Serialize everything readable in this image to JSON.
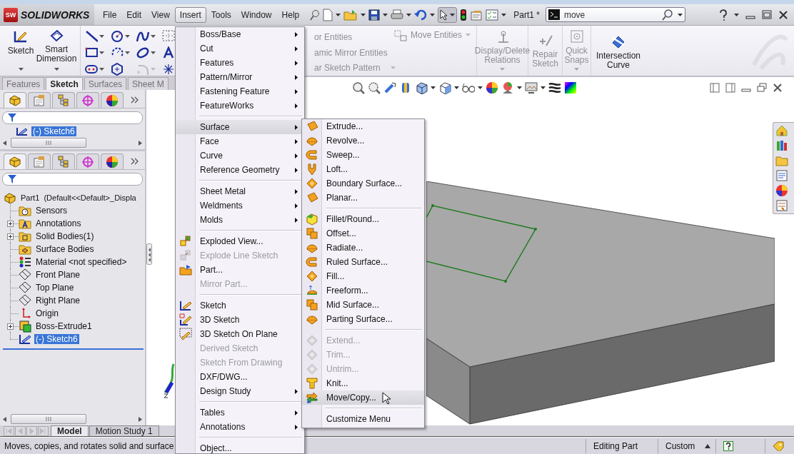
{
  "title_bar": {
    "logo_badge": "SW",
    "logo": "SOLIDWORKS",
    "menus": [
      {
        "label": "File",
        "selected": false
      },
      {
        "label": "Edit",
        "selected": false
      },
      {
        "label": "View",
        "selected": false
      },
      {
        "label": "Insert",
        "selected": true
      },
      {
        "label": "Tools",
        "selected": false
      },
      {
        "label": "Window",
        "selected": false
      },
      {
        "label": "Help",
        "selected": false
      }
    ],
    "document": "Part1 *",
    "search": {
      "value": "move"
    }
  },
  "command_manager": {
    "sketch_tools": [
      {
        "label": "Sketch",
        "dropdown": true,
        "disabled": false
      },
      {
        "label": "Smart Dimension",
        "dropdown": true,
        "disabled": false
      }
    ],
    "entity_tools": [
      {
        "label": "or Entities",
        "dropdown": false,
        "disabled": true
      },
      {
        "label": "amic Mirror Entities",
        "dropdown": false,
        "disabled": true
      },
      {
        "label": "ar Sketch Pattern",
        "dropdown": true,
        "disabled": true
      }
    ],
    "move_entities": {
      "label": "Move Entities",
      "dropdown": true,
      "disabled": true
    },
    "relation_tools": [
      {
        "label": "Display/Delete Relations",
        "dropdown": true,
        "disabled": true
      },
      {
        "label": "Repair Sketch",
        "dropdown": false,
        "disabled": true
      },
      {
        "label": "Quick Snaps",
        "dropdown": true,
        "disabled": true
      },
      {
        "label": "Intersection Curve",
        "dropdown": false,
        "disabled": false
      }
    ]
  },
  "command_tabs": [
    {
      "label": "Features",
      "selected": false
    },
    {
      "label": "Sketch",
      "selected": true
    },
    {
      "label": "Surfaces",
      "selected": false
    },
    {
      "label": "Sheet M",
      "selected": false
    }
  ],
  "flyout_tree": {
    "panel_tabs": [
      {
        "selected": true
      },
      {
        "selected": false
      },
      {
        "selected": false
      },
      {
        "selected": false
      },
      {
        "selected": false
      }
    ],
    "item": {
      "label": "(-) Sketch6",
      "selected": true
    }
  },
  "feature_tree": {
    "panel_tabs": [
      {
        "selected": true
      },
      {
        "selected": false
      },
      {
        "selected": false
      },
      {
        "selected": false
      },
      {
        "selected": false
      }
    ],
    "root": {
      "label": "Part1  (Default<<Default>_Displa",
      "children": [
        {
          "label": "Sensors",
          "expandable": false,
          "selected": false
        },
        {
          "label": "Annotations",
          "expandable": true,
          "selected": false
        },
        {
          "label": "Solid Bodies(1)",
          "expandable": true,
          "selected": false
        },
        {
          "label": "Surface Bodies",
          "expandable": false,
          "selected": false
        },
        {
          "label": "Material <not specified>",
          "expandable": false,
          "selected": false
        },
        {
          "label": "Front Plane",
          "expandable": false,
          "selected": false
        },
        {
          "label": "Top Plane",
          "expandable": false,
          "selected": false
        },
        {
          "label": "Right Plane",
          "expandable": false,
          "selected": false
        },
        {
          "label": "Origin",
          "expandable": false,
          "selected": false
        },
        {
          "label": "Boss-Extrude1",
          "expandable": true,
          "selected": false
        },
        {
          "label": "(-) Sketch6",
          "expandable": false,
          "selected": true
        }
      ]
    }
  },
  "bottom_tabs": [
    {
      "label": "Model",
      "selected": true
    },
    {
      "label": "Motion Study 1",
      "selected": false
    }
  ],
  "status_bar": {
    "message": "Moves, copies, and rotates solid and surface",
    "mode": "Editing Part",
    "units": "Custom"
  },
  "insert_menu": {
    "items": [
      {
        "kind": "item",
        "label": "Boss/Base",
        "submenu": true,
        "disabled": false,
        "selected": false
      },
      {
        "kind": "item",
        "label": "Cut",
        "submenu": true,
        "disabled": false,
        "selected": false
      },
      {
        "kind": "item",
        "label": "Features",
        "submenu": true,
        "disabled": false,
        "selected": false
      },
      {
        "kind": "item",
        "label": "Pattern/Mirror",
        "submenu": true,
        "disabled": false,
        "selected": false
      },
      {
        "kind": "item",
        "label": "Fastening Feature",
        "submenu": true,
        "disabled": false,
        "selected": false
      },
      {
        "kind": "item",
        "label": "FeatureWorks",
        "submenu": true,
        "disabled": false,
        "selected": false
      },
      {
        "kind": "separator"
      },
      {
        "kind": "item",
        "label": "Surface",
        "submenu": true,
        "disabled": false,
        "selected": true
      },
      {
        "kind": "item",
        "label": "Face",
        "submenu": true,
        "disabled": false,
        "selected": false
      },
      {
        "kind": "item",
        "label": "Curve",
        "submenu": true,
        "disabled": false,
        "selected": false
      },
      {
        "kind": "item",
        "label": "Reference Geometry",
        "submenu": true,
        "disabled": false,
        "selected": false
      },
      {
        "kind": "separator"
      },
      {
        "kind": "item",
        "label": "Sheet Metal",
        "submenu": true,
        "disabled": false,
        "selected": false
      },
      {
        "kind": "item",
        "label": "Weldments",
        "submenu": true,
        "disabled": false,
        "selected": false
      },
      {
        "kind": "item",
        "label": "Molds",
        "submenu": true,
        "disabled": false,
        "selected": false
      },
      {
        "kind": "separator"
      },
      {
        "kind": "item",
        "label": "Exploded View...",
        "submenu": false,
        "disabled": false,
        "selected": false
      },
      {
        "kind": "item",
        "label": "Explode Line Sketch",
        "submenu": false,
        "disabled": true,
        "selected": false
      },
      {
        "kind": "item",
        "label": "Part...",
        "submenu": false,
        "disabled": false,
        "selected": false
      },
      {
        "kind": "item",
        "label": "Mirror Part...",
        "submenu": false,
        "disabled": true,
        "selected": false
      },
      {
        "kind": "separator"
      },
      {
        "kind": "item",
        "label": "Sketch",
        "submenu": false,
        "disabled": false,
        "selected": false
      },
      {
        "kind": "item",
        "label": "3D Sketch",
        "submenu": false,
        "disabled": false,
        "selected": false
      },
      {
        "kind": "item",
        "label": "3D Sketch On Plane",
        "submenu": false,
        "disabled": false,
        "selected": false
      },
      {
        "kind": "item",
        "label": "Derived Sketch",
        "submenu": false,
        "disabled": true,
        "selected": false
      },
      {
        "kind": "item",
        "label": "Sketch From Drawing",
        "submenu": false,
        "disabled": true,
        "selected": false
      },
      {
        "kind": "item",
        "label": "DXF/DWG...",
        "submenu": false,
        "disabled": false,
        "selected": false
      },
      {
        "kind": "item",
        "label": "Design Study",
        "submenu": true,
        "disabled": false,
        "selected": false
      },
      {
        "kind": "separator"
      },
      {
        "kind": "item",
        "label": "Tables",
        "submenu": true,
        "disabled": false,
        "selected": false
      },
      {
        "kind": "item",
        "label": "Annotations",
        "submenu": true,
        "disabled": false,
        "selected": false
      },
      {
        "kind": "separator"
      },
      {
        "kind": "item",
        "label": "Object...",
        "submenu": false,
        "disabled": false,
        "selected": false
      }
    ]
  },
  "surface_submenu": {
    "items": [
      {
        "kind": "item",
        "label": "Extrude...",
        "submenu": false,
        "disabled": false,
        "selected": false
      },
      {
        "kind": "item",
        "label": "Revolve...",
        "submenu": false,
        "disabled": false,
        "selected": false
      },
      {
        "kind": "item",
        "label": "Sweep...",
        "submenu": false,
        "disabled": false,
        "selected": false
      },
      {
        "kind": "item",
        "label": "Loft...",
        "submenu": false,
        "disabled": false,
        "selected": false
      },
      {
        "kind": "item",
        "label": "Boundary Surface...",
        "submenu": false,
        "disabled": false,
        "selected": false
      },
      {
        "kind": "item",
        "label": "Planar...",
        "submenu": false,
        "disabled": false,
        "selected": false
      },
      {
        "kind": "separator"
      },
      {
        "kind": "item",
        "label": "Fillet/Round...",
        "submenu": false,
        "disabled": false,
        "selected": false
      },
      {
        "kind": "item",
        "label": "Offset...",
        "submenu": false,
        "disabled": false,
        "selected": false
      },
      {
        "kind": "item",
        "label": "Radiate...",
        "submenu": false,
        "disabled": false,
        "selected": false
      },
      {
        "kind": "item",
        "label": "Ruled Surface...",
        "submenu": false,
        "disabled": false,
        "selected": false
      },
      {
        "kind": "item",
        "label": "Fill...",
        "submenu": false,
        "disabled": false,
        "selected": false
      },
      {
        "kind": "item",
        "label": "Freeform...",
        "submenu": false,
        "disabled": false,
        "selected": false
      },
      {
        "kind": "item",
        "label": "Mid Surface...",
        "submenu": false,
        "disabled": false,
        "selected": false
      },
      {
        "kind": "item",
        "label": "Parting Surface...",
        "submenu": false,
        "disabled": false,
        "selected": false
      },
      {
        "kind": "separator"
      },
      {
        "kind": "item",
        "label": "Extend...",
        "submenu": false,
        "disabled": true,
        "selected": false
      },
      {
        "kind": "item",
        "label": "Trim...",
        "submenu": false,
        "disabled": true,
        "selected": false
      },
      {
        "kind": "item",
        "label": "Untrim...",
        "submenu": false,
        "disabled": true,
        "selected": false
      },
      {
        "kind": "item",
        "label": "Knit...",
        "submenu": false,
        "disabled": false,
        "selected": false
      },
      {
        "kind": "item",
        "label": "Move/Copy...",
        "submenu": false,
        "disabled": false,
        "selected": true
      },
      {
        "kind": "separator"
      },
      {
        "kind": "item",
        "label": "Customize Menu",
        "submenu": false,
        "disabled": false,
        "selected": false
      }
    ]
  }
}
